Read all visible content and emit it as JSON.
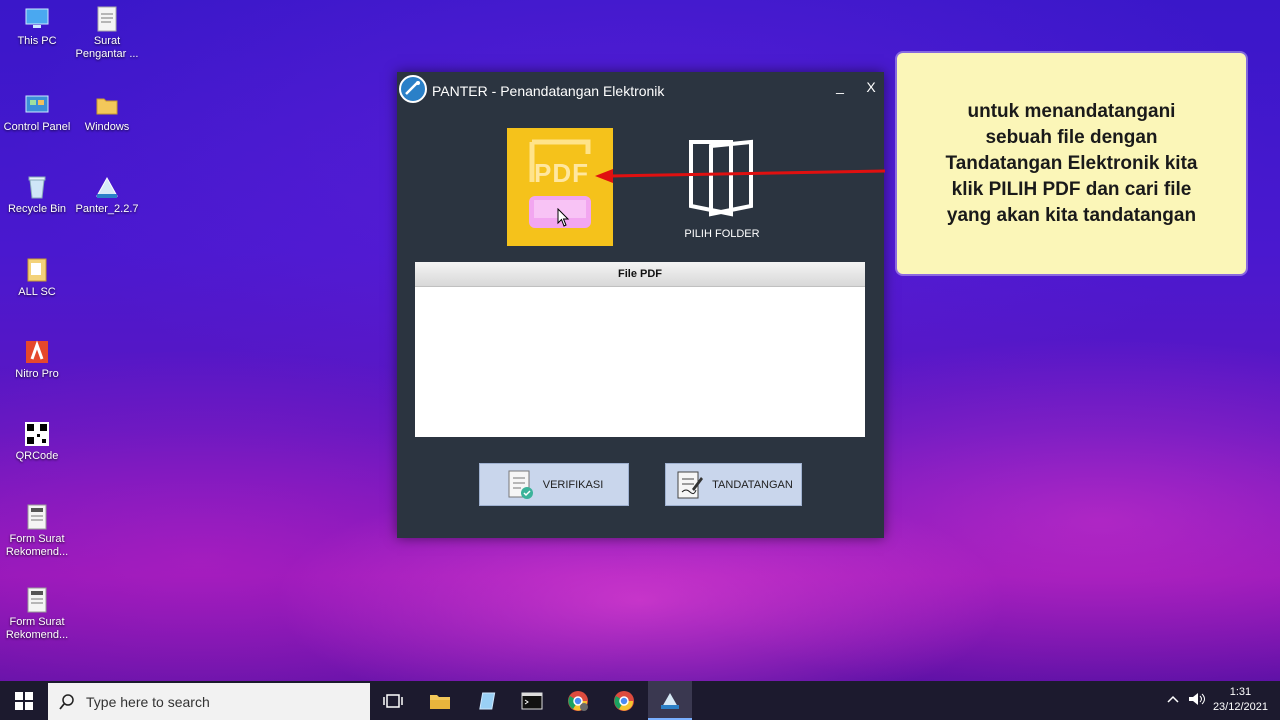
{
  "desktop": {
    "icons": [
      {
        "label": "This PC",
        "icon": "this-pc-icon"
      },
      {
        "label": "Surat Pengantar ...",
        "icon": "document-icon"
      },
      {
        "label": "Control Panel",
        "icon": "control-panel-icon"
      },
      {
        "label": "Windows",
        "icon": "folder-icon"
      },
      {
        "label": "Recycle Bin",
        "icon": "recycle-bin-icon"
      },
      {
        "label": "Panter_2.2.7",
        "icon": "panter-app-icon"
      },
      {
        "label": "ALL SC",
        "icon": "folder-icon"
      },
      {
        "label": "Nitro Pro",
        "icon": "nitro-pro-icon"
      },
      {
        "label": "QRCode",
        "icon": "qrcode-icon"
      },
      {
        "label": "Form Surat Rekomend...",
        "icon": "document-icon"
      },
      {
        "label": "Form Surat Rekomend...",
        "icon": "document-icon"
      }
    ]
  },
  "window": {
    "title": "PANTER - Penandatangan Elektronik",
    "minimize_label": "_",
    "close_label": "X",
    "pdf_tile_text": "PDF",
    "pilih_folder_label": "PILIH FOLDER",
    "file_table_header": "File PDF",
    "verifikasi_label": "VERIFIKASI",
    "tandatangan_label": "TANDATANGAN"
  },
  "callout": {
    "lines": [
      "untuk menandatangani",
      "sebuah file dengan",
      "Tandatangan Elektronik kita",
      "klik PILIH PDF dan cari file",
      "yang akan kita tandatangan"
    ],
    "arrow_color": "#e01010"
  },
  "taskbar": {
    "search_placeholder": "Type here to search",
    "time": "1:31",
    "date": "23/12/2021",
    "apps": [
      "task-view-icon",
      "file-explorer-icon",
      "notepad-icon",
      "terminal-icon",
      "chrome-alt-icon",
      "chrome-icon",
      "panter-taskbar-icon"
    ]
  },
  "colors": {
    "window_bg": "#2b3440",
    "pdf_tile": "#f5c21b",
    "button_bg": "#c9d6ec",
    "callout_bg": "#fbf6b8"
  }
}
